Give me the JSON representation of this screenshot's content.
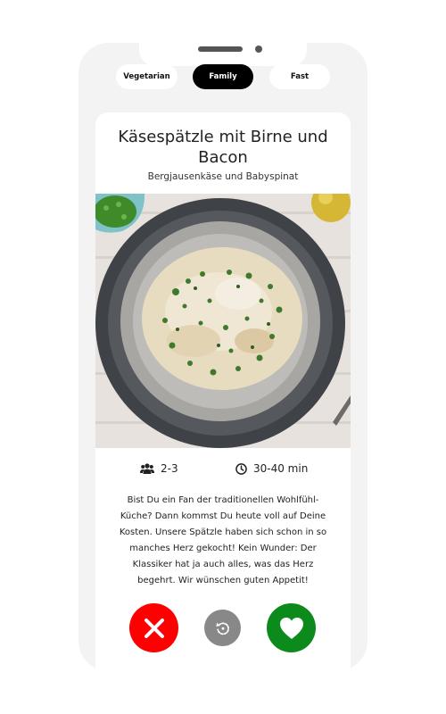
{
  "filters": [
    {
      "label": "Vegetarian",
      "active": false
    },
    {
      "label": "Family",
      "active": true
    },
    {
      "label": "Fast",
      "active": false
    }
  ],
  "recipe": {
    "title": "Käsespätzle mit Birne und Bacon",
    "subtitle": "Bergjausenkäse und Babyspinat",
    "servings": "2-3",
    "time": "30-40 min",
    "description": "Bist Du ein Fan der traditionellen Wohlfühl-Küche? Dann kommst Du heute voll auf Deine Kosten. Unsere Spätzle haben sich schon in so manches Herz gekocht! Kein Wunder: Der Klassiker hat ja auch alles, was das Herz begehrt. Wir wünschen guten Appetit!"
  },
  "actions": {
    "dislike_icon": "close-icon",
    "undo_icon": "undo-icon",
    "like_icon": "heart-icon"
  },
  "colors": {
    "dislike": "#ff0000",
    "undo": "#888888",
    "like": "#0c8a1c",
    "active_chip": "#000000"
  }
}
